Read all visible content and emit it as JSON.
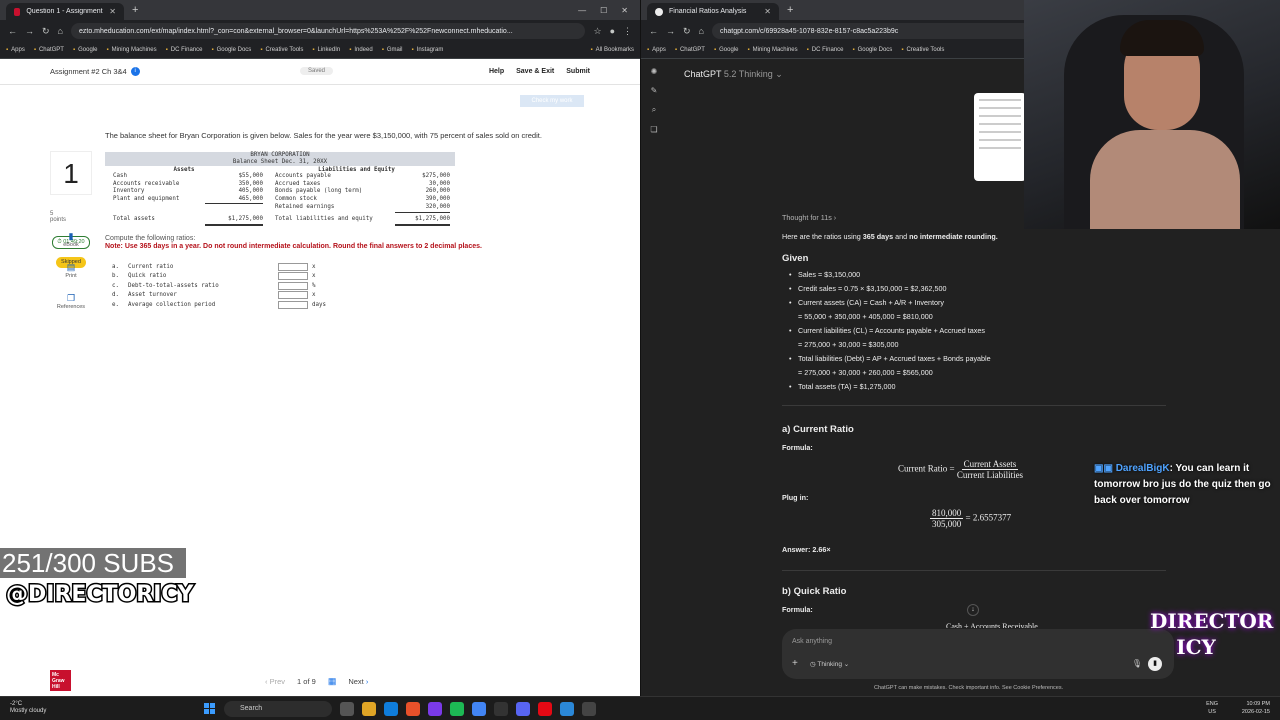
{
  "left_browser": {
    "tab_title": "Question 1 - Assignment #2 Ch",
    "url": "ezto.mheducation.com/ext/map/index.html?_con=con&external_browser=0&launchUrl=https%253A%252F%252Fnewconnect.mheducatio...",
    "bookmarks": [
      "Apps",
      "ChatGPT",
      "Google",
      "Mining Machines",
      "DC Finance",
      "Google Docs",
      "Creative Tools",
      "LinkedIn",
      "Indeed",
      "Gmail",
      "Instagram",
      "All Bookmarks"
    ]
  },
  "assignment": {
    "title": "Assignment #2 Ch 3&4",
    "saved": "Saved",
    "links": [
      "Help",
      "Save & Exit",
      "Submit"
    ],
    "check_work": "Check my work",
    "question_number": "1",
    "points_value": "5",
    "points_label": "points",
    "timer": "01:49:20",
    "status": "Skipped",
    "tools": [
      "eBook",
      "Print",
      "References"
    ],
    "question": "The balance sheet for Bryan Corporation is given below. Sales for the year were $3,150,000, with 75 percent of sales sold on credit.",
    "sheet_company": "BRYAN CORPORATION",
    "sheet_subtitle": "Balance Sheet Dec. 31, 20XX",
    "assets_header": "Assets",
    "liab_header": "Liabilities and Equity",
    "rows": [
      {
        "a": "Cash",
        "av": "$55,000",
        "l": "Accounts payable",
        "lv": "$275,000"
      },
      {
        "a": "Accounts receivable",
        "av": "350,000",
        "l": "Accrued taxes",
        "lv": "30,000"
      },
      {
        "a": "Inventory",
        "av": "405,000",
        "l": "Bonds payable (long term)",
        "lv": "260,000"
      },
      {
        "a": "Plant and equipment",
        "av": "465,000",
        "l": "Common stock",
        "lv": "390,000"
      },
      {
        "a": "",
        "av": "",
        "l": "Retained earnings",
        "lv": "320,000"
      }
    ],
    "total_assets_label": "Total assets",
    "total_assets": "$1,275,000",
    "total_liab_label": "Total liabilities and equity",
    "total_liab": "$1,275,000",
    "compute": "Compute the following ratios:",
    "note": "Note: Use 365 days in a year. Do not round intermediate calculation. Round the final answers to 2 decimal places.",
    "ratios": [
      {
        "letter": "a.",
        "name": "Current ratio",
        "unit": "x"
      },
      {
        "letter": "b.",
        "name": "Quick ratio",
        "unit": "x"
      },
      {
        "letter": "c.",
        "name": "Debt-to-total-assets ratio",
        "unit": "%"
      },
      {
        "letter": "d.",
        "name": "Asset turnover",
        "unit": "x"
      },
      {
        "letter": "e.",
        "name": "Average collection period",
        "unit": "days"
      }
    ],
    "pager": {
      "prev": "Prev",
      "page": "1",
      "of": "of",
      "total": "9",
      "next": "Next"
    },
    "logo": "Mc Graw Hill"
  },
  "overlay": {
    "subs": "251/300 SUBS",
    "handle": "@DIRECTORICY",
    "chat_user": "DarealBigK",
    "chat_text": ": You can learn it tomorrow bro jus do the quiz then go back over tomorrow",
    "logo": "DIRECTOR ICY"
  },
  "right_browser": {
    "tab_title": "Financial Ratios Analysis",
    "url": "chatgpt.com/c/69928a45-1078-832e-8157-c8ac5a223b9c",
    "bookmarks": [
      "Apps",
      "ChatGPT",
      "Google",
      "Mining Machines",
      "DC Finance",
      "Google Docs",
      "Creative Tools"
    ]
  },
  "chatgpt": {
    "model": "ChatGPT",
    "model_suffix": "5.2 Thinking",
    "thought": "Thought for 11s",
    "intro_a": "Here are the ratios using ",
    "intro_b": "365 days",
    "intro_c": " and ",
    "intro_d": "no intermediate rounding.",
    "given": "Given",
    "given_lines": [
      "Sales = $3,150,000",
      "Credit sales = 0.75 × $3,150,000 = $2,362,500",
      "Current assets (CA) = Cash + A/R + Inventory",
      "= 55,000 + 350,000 + 405,000 = $810,000",
      "Current liabilities (CL) = Accounts payable + Accrued taxes",
      "= 275,000 + 30,000 = $305,000",
      "Total liabilities (Debt) = AP + Accrued taxes + Bonds payable",
      "= 275,000 + 30,000 + 260,000 = $565,000",
      "Total assets (TA) = $1,275,000"
    ],
    "a_title": "a) Current Ratio",
    "formula": "Formula:",
    "cr_lhs": "Current Ratio =",
    "cr_num": "Current Assets",
    "cr_den": "Current Liabilities",
    "plug": "Plug in:",
    "plug_num": "810,000",
    "plug_den": "305,000",
    "plug_res": "= 2.6557377",
    "answer": "Answer: 2.66×",
    "b_title": "b) Quick Ratio",
    "formula2": "Formula:",
    "cut_text": "Cash + Accounts Receivable",
    "input_placeholder": "Ask anything",
    "thinking_chip": "Thinking",
    "disclaimer": "ChatGPT can make mistakes. Check important info. See Cookie Preferences."
  },
  "taskbar": {
    "temp": "-2°C",
    "weather": "Mostly cloudy",
    "search": "Search",
    "lang1": "ENG",
    "lang2": "US",
    "time": "10:09 PM",
    "date": "2026-02-15"
  }
}
